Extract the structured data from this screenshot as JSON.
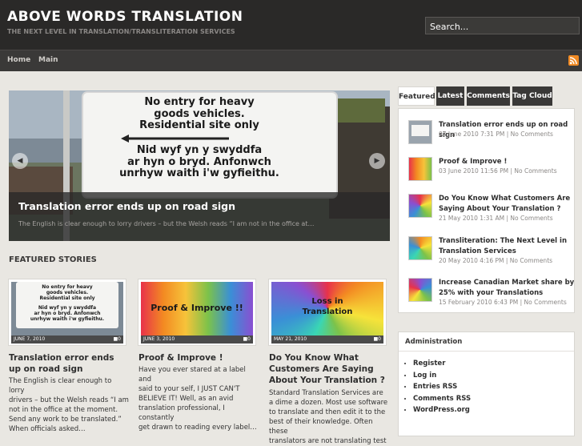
{
  "header": {
    "title": "ABOVE WORDS TRANSLATION",
    "tagline": "THE NEXT LEVEL IN TRANSLATION/TRANSLITERATION SERVICES",
    "search_value": "Search..."
  },
  "nav": {
    "items": [
      "Home",
      "Main"
    ]
  },
  "icons": {
    "rss": "rss-feed-icon",
    "prev": "chevron-left-icon",
    "next": "chevron-right-icon",
    "comment": "comment-icon"
  },
  "slider": {
    "title": "Translation error ends up on road sign",
    "excerpt": "The English is clear enough to lorry drivers – but the Welsh reads “I am not in the office at…",
    "sign_text": [
      "No entry for heavy",
      "goods vehicles.",
      "Residential site only",
      "Nid wyf yn y swyddfa",
      "ar hyn o bryd. Anfonwch",
      "unrhyw waith i'w gyfieithu."
    ]
  },
  "featured": {
    "heading": "FEATURED STORIES",
    "stories": [
      {
        "date": "JUNE 7, 2010",
        "comments": "0",
        "title": "Translation error ends up on road sign",
        "text": [
          "The English is clear enough to lorry",
          "drivers – but the Welsh reads “I am",
          "not in the office at the moment.",
          "Send any work to be translated.”",
          "When officials asked…"
        ]
      },
      {
        "date": "JUNE 3, 2010",
        "comments": "0",
        "image_text": "Proof & Improve !!",
        "title": "Proof & Improve !",
        "text": [
          "Have you ever stared at a label and",
          "said to your self, I JUST CAN'T",
          "BELIEVE IT! Well, as an avid",
          "translation professional, I constantly",
          "get drawn to reading every label…"
        ]
      },
      {
        "date": "MAY 21, 2010",
        "comments": "0",
        "image_text": [
          "Loss in",
          "Translation"
        ],
        "title": "Do You Know What Customers Are Saying About Your Translation ?",
        "text": [
          "Standard Translation Services are",
          "a dime a dozen. Most use software",
          "to translate and then edit it to the",
          "best of their knowledge. Often these",
          "translators are not translating test"
        ]
      }
    ]
  },
  "sidebar": {
    "tabs": [
      "Featured",
      "Latest",
      "Comments",
      "Tag Cloud"
    ],
    "posts": [
      {
        "title": "Translation error ends up on road sign",
        "meta": "07 June 2010 7:31 PM | No Comments"
      },
      {
        "title": "Proof & Improve !",
        "meta": "03 June 2010 11:56 PM | No Comments"
      },
      {
        "title": "Do You Know What Customers Are Saying About Your Translation ?",
        "meta": "21 May 2010 1:31 AM | No Comments"
      },
      {
        "title": "Transliteration: The Next Level in Translation Services",
        "meta": "20 May 2010 4:16 PM | No Comments"
      },
      {
        "title": "Increase Canadian Market share by 25% with your Translations",
        "meta": "15 February 2010 6:43 PM | No Comments"
      }
    ],
    "admin_heading": "Administration",
    "admin_links": [
      "Register",
      "Log in",
      "Entries RSS",
      "Comments RSS",
      "WordPress.org"
    ]
  },
  "colors": {
    "header_bg": "#2a2928",
    "nav_bg": "#3a3938",
    "page_bg": "#e9e7e2",
    "rss": "#f08a24"
  }
}
